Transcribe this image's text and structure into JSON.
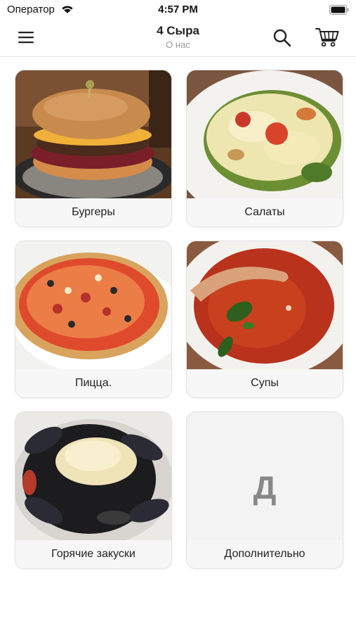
{
  "status_bar": {
    "carrier": "Оператор",
    "time": "4:57 PM"
  },
  "header": {
    "title": "4 Сыра",
    "subtitle": "О нас"
  },
  "icons": {
    "menu": "menu-icon",
    "search": "search-icon",
    "cart": "cart-icon"
  },
  "categories": [
    {
      "label": "Бургеры"
    },
    {
      "label": "Салаты"
    },
    {
      "label": "Пицца."
    },
    {
      "label": "Супы"
    },
    {
      "label": "Горячие закуски"
    },
    {
      "label": "Дополнительно",
      "placeholder_letter": "Д"
    }
  ]
}
